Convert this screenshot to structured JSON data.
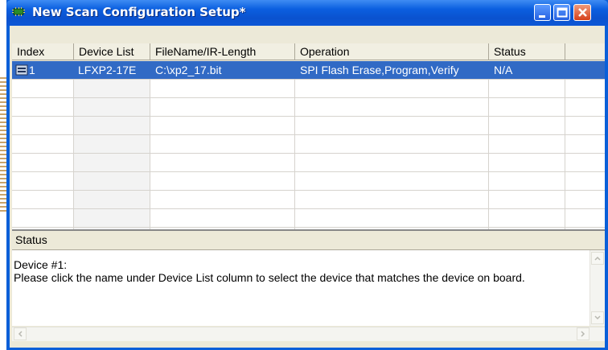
{
  "window": {
    "title": "New Scan Configuration Setup*"
  },
  "grid": {
    "columns": [
      "Index",
      "Device List",
      "FileName/IR-Length",
      "Operation",
      "Status"
    ],
    "rows": [
      {
        "index": "1",
        "device": "LFXP2-17E",
        "file": "C:\\xp2_17.bit",
        "operation": "SPI Flash Erase,Program,Verify",
        "status": "N/A"
      }
    ]
  },
  "status_panel": {
    "title": "Status",
    "line1": "Device #1:",
    "line2": "Please click the name under Device List column to select the device that matches the device on board."
  },
  "colors": {
    "titlebar": "#0a5fd8",
    "selection": "#316ac5",
    "close": "#d6401b"
  }
}
